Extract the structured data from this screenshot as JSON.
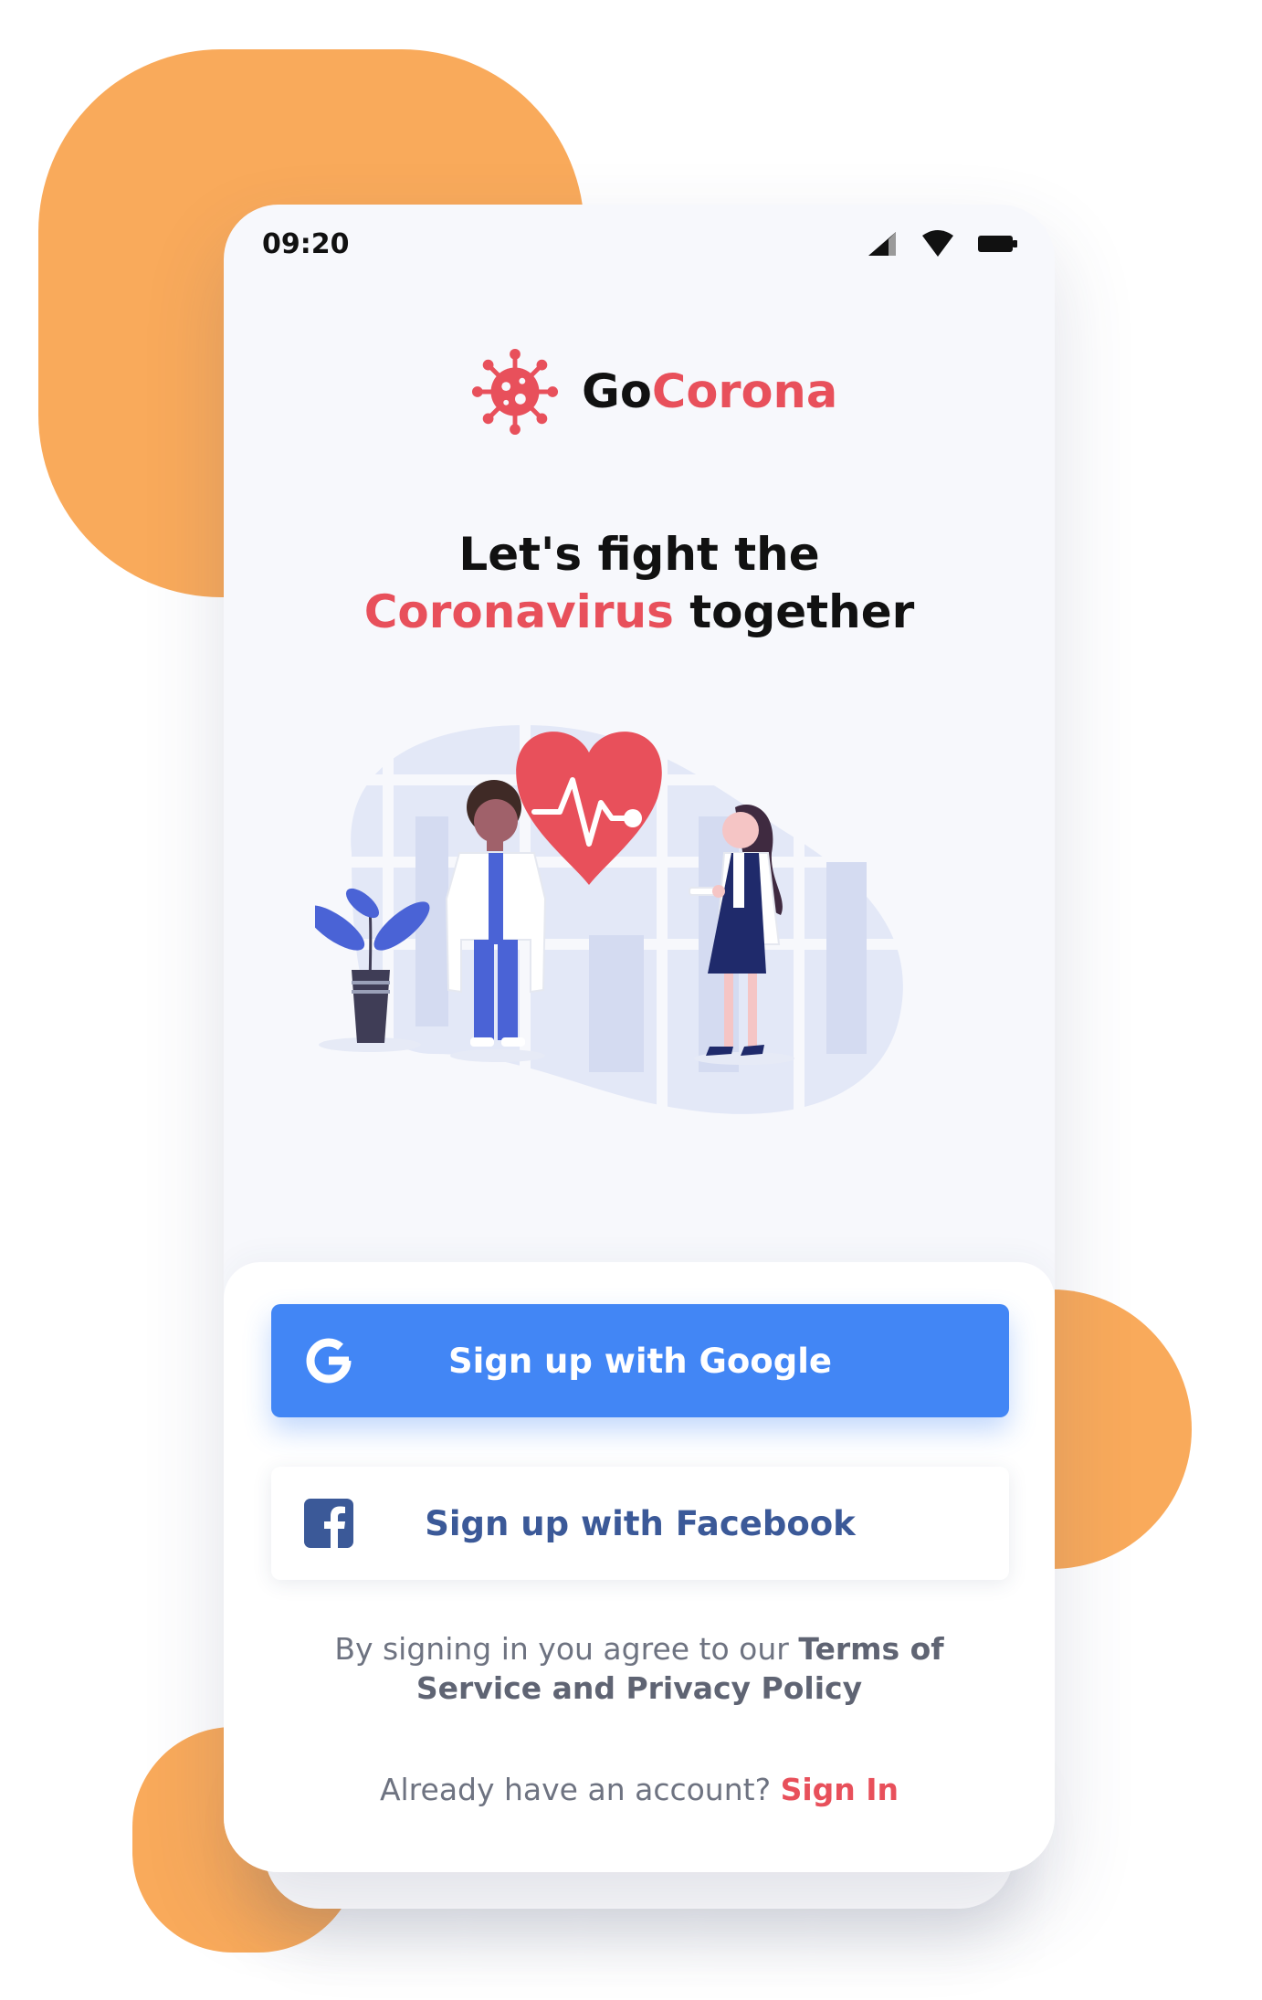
{
  "status_bar": {
    "time": "09:20"
  },
  "app": {
    "name_part1": "Go",
    "name_part2": "Corona"
  },
  "headline": {
    "line1": "Let's fight the",
    "accent": "Coronavirus",
    "line2_rest": " together"
  },
  "buttons": {
    "google": "Sign up with Google",
    "facebook": "Sign up with Facebook"
  },
  "terms": {
    "prefix": "By signing in you agree to our ",
    "link_line1": "Terms of",
    "link_line2": "Service and Privacy Policy"
  },
  "signin": {
    "prompt": "Already have an account? ",
    "link": "Sign In"
  },
  "colors": {
    "accent": "#E8505B",
    "google_blue": "#4286F5",
    "facebook_blue": "#3B5998",
    "blob_orange": "#F9AA5B",
    "text_dark": "#111111",
    "text_muted": "#6E7381"
  },
  "icons": [
    "virus-icon",
    "signal-icon",
    "wifi-icon",
    "battery-icon",
    "google-icon",
    "facebook-icon",
    "heart-pulse-icon"
  ]
}
